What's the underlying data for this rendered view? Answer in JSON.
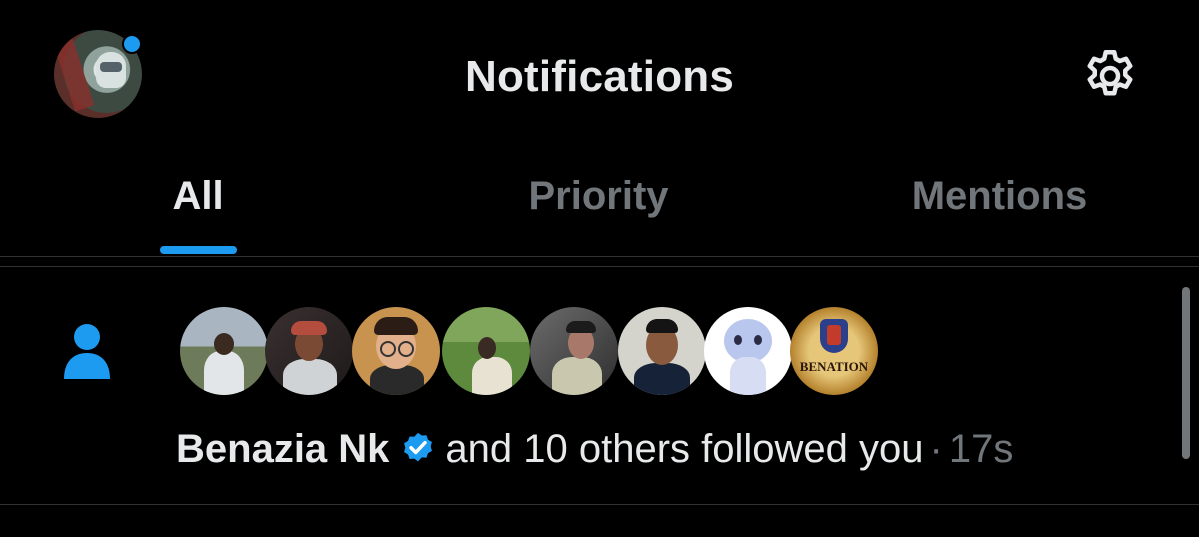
{
  "header": {
    "title": "Notifications",
    "profile_icon": "profile-avatar",
    "settings_icon": "gear-icon",
    "unread_indicator_color": "#1d9bf0"
  },
  "tabs": [
    {
      "label": "All",
      "active": true
    },
    {
      "label": "Priority",
      "active": false
    },
    {
      "label": "Mentions",
      "active": false
    }
  ],
  "accent_color": "#1d9bf0",
  "notification": {
    "type_icon": "person-icon",
    "avatar_count": 8,
    "name": "Benazia Nk",
    "verified_icon": "verified-badge-icon",
    "action": "and 10 others followed you",
    "separator": "·",
    "time": "17s"
  },
  "avatar_logo_text": "BENATION"
}
